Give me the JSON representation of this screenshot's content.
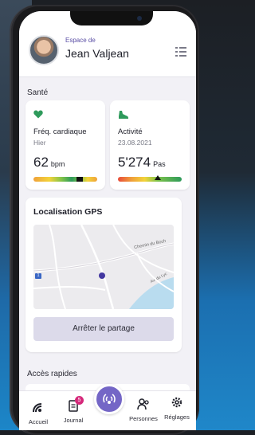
{
  "header": {
    "espace_label": "Espace de",
    "user_name": "Jean Valjean"
  },
  "sante": {
    "title": "Santé",
    "heart": {
      "label": "Fréq. cardiaque",
      "sub": "Hier",
      "value": "62",
      "unit": "bpm",
      "icon": "heart-icon"
    },
    "activity": {
      "label": "Activité",
      "sub": "23.08.2021",
      "value": "5'274",
      "unit": "Pas",
      "icon": "shoe-icon"
    }
  },
  "gps": {
    "title": "Localisation GPS",
    "street1": "Chemin du Boch",
    "street2": "Av. du Lyc",
    "road_number": "1",
    "stop_label": "Arrêter le partage"
  },
  "quick": {
    "title": "Accès rapides"
  },
  "tabs": [
    {
      "label": "Accueil",
      "icon": "home-icon"
    },
    {
      "label": "Journal",
      "icon": "journal-icon",
      "badge": "5"
    },
    {
      "label": "",
      "icon": "sos-signal-icon"
    },
    {
      "label": "Personnes",
      "icon": "people-icon"
    },
    {
      "label": "Réglages",
      "icon": "gear-icon"
    }
  ],
  "colors": {
    "accent": "#7466c6",
    "heart_green": "#2e9a5b",
    "badge": "#d5287a"
  }
}
